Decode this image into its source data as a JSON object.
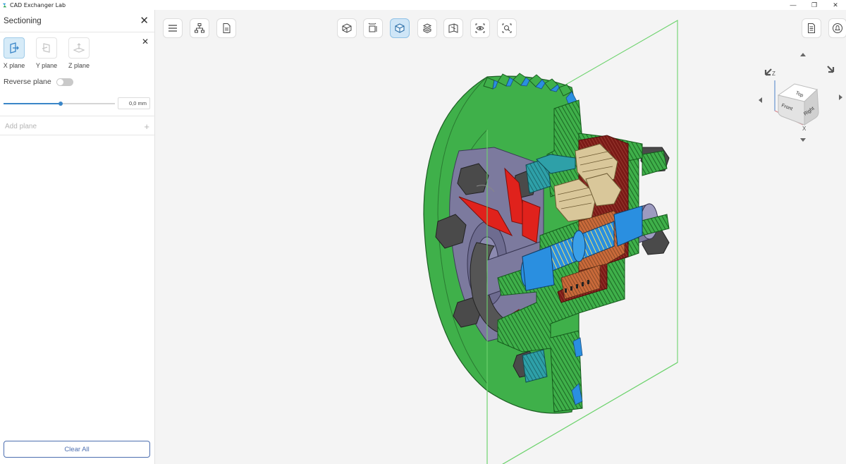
{
  "window": {
    "title": "CAD Exchanger Lab",
    "controls": [
      "—",
      "❐",
      "✕"
    ]
  },
  "sidebar": {
    "panel_title": "Sectioning",
    "planes": [
      {
        "label": "X plane",
        "active": true
      },
      {
        "label": "Y plane",
        "active": false
      },
      {
        "label": "Z plane",
        "active": false
      }
    ],
    "reverse_plane_label": "Reverse plane",
    "reverse_plane_on": false,
    "offset_value": "0,0 mm",
    "offset_fraction": 0.51,
    "add_plane_label": "Add plane",
    "clear_all_label": "Clear All"
  },
  "toolbar": {
    "left": [
      "menu-icon",
      "structure-tree-icon",
      "properties-icon"
    ],
    "center": [
      "view-mode-icon",
      "dimensions-icon",
      "sectioning-icon",
      "explode-icon",
      "projection-icon",
      "visibility-icon",
      "fit-all-icon"
    ],
    "active": "sectioning-icon",
    "right": [
      "document-icon",
      "notifications-icon"
    ]
  },
  "navcube": {
    "faces": [
      "Top",
      "Front",
      "Right"
    ],
    "axes": [
      "Z",
      "X"
    ]
  },
  "colors": {
    "accent": "#3a86c8",
    "button_border": "#4d6fb0",
    "section_plane": "#6ed36e",
    "housing_green": "#3fb04a",
    "section_hatch": "#1d6b25",
    "shaft_blue": "#2a8fe0",
    "teal": "#2ea0a8",
    "gear_tan": "#d9c79a",
    "red_part": "#e0221c",
    "dark_part": "#4a4a4a",
    "slate": "#7c7a9e"
  }
}
